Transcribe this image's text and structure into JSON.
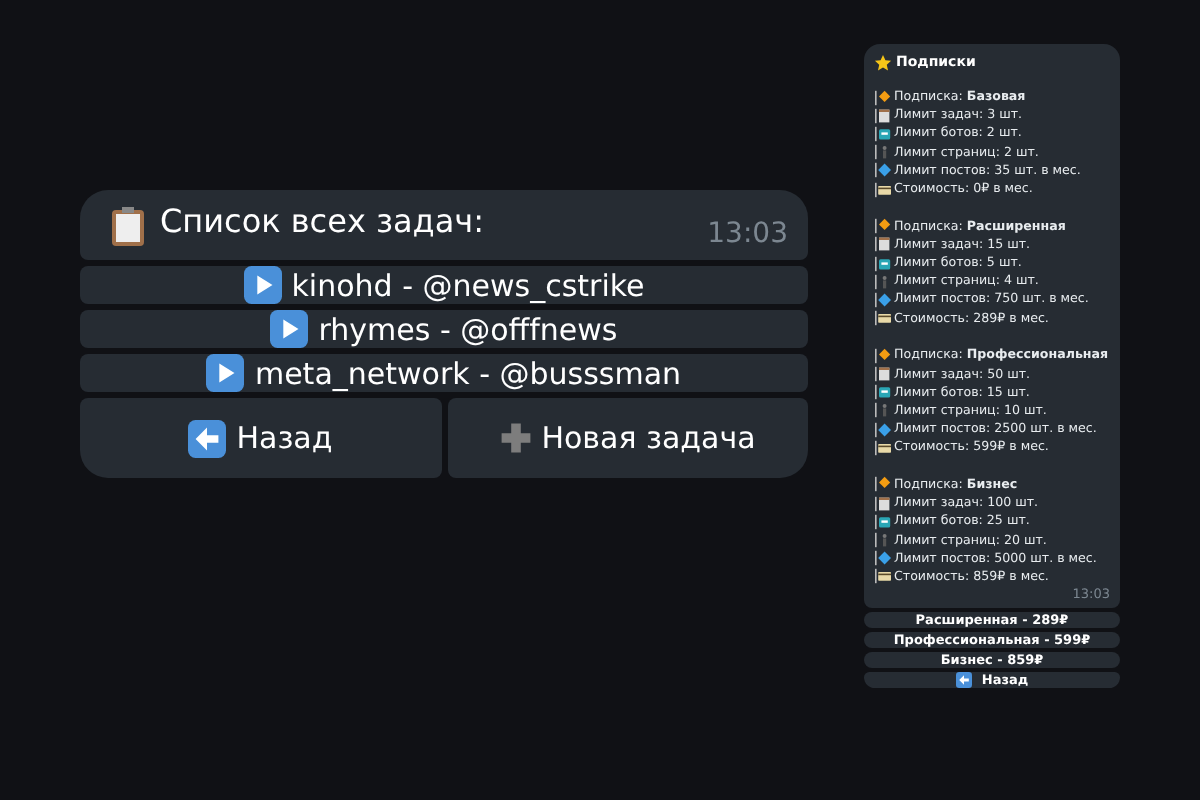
{
  "task_list": {
    "title": "Список всех задач:",
    "time": "13:03",
    "tasks": [
      "kinohd - @news_cstrike",
      "rhymes - @offfnews",
      "meta_network - @busssman"
    ],
    "back_button": "Назад",
    "new_task_button": "Новая задача"
  },
  "subscriptions": {
    "title": "Подписки",
    "time": "13:03",
    "plans": [
      {
        "lines": [
          {
            "kind": "plan",
            "text": "Подписка: **Базовая**"
          },
          {
            "kind": "tasks",
            "text": "Лимит задач: 3 шт."
          },
          {
            "kind": "bots",
            "text": "Лимит ботов: 2 шт."
          },
          {
            "kind": "pages",
            "text": "Лимит страниц: 2 шт."
          },
          {
            "kind": "posts",
            "text": "Лимит постов: 35 шт. в мес."
          },
          {
            "kind": "cost",
            "text": "Стоимость: 0₽ в мес."
          }
        ]
      },
      {
        "lines": [
          {
            "kind": "plan",
            "text": "Подписка: **Расширенная**"
          },
          {
            "kind": "tasks",
            "text": "Лимит задач: 15 шт."
          },
          {
            "kind": "bots",
            "text": "Лимит ботов: 5 шт."
          },
          {
            "kind": "pages",
            "text": "Лимит страниц: 4 шт."
          },
          {
            "kind": "posts",
            "text": "Лимит постов: 750 шт. в мес."
          },
          {
            "kind": "cost",
            "text": "Стоимость: 289₽ в мес."
          }
        ]
      },
      {
        "lines": [
          {
            "kind": "plan",
            "text": "Подписка: **Профессиональная**"
          },
          {
            "kind": "tasks",
            "text": "Лимит задач: 50 шт."
          },
          {
            "kind": "bots",
            "text": "Лимит ботов: 15 шт."
          },
          {
            "kind": "pages",
            "text": "Лимит страниц: 10 шт."
          },
          {
            "kind": "posts",
            "text": "Лимит постов: 2500 шт. в мес."
          },
          {
            "kind": "cost",
            "text": "Стоимость: 599₽ в мес."
          }
        ]
      },
      {
        "lines": [
          {
            "kind": "plan",
            "text": "Подписка: **Бизнес**"
          },
          {
            "kind": "tasks",
            "text": "Лимит задач: 100 шт."
          },
          {
            "kind": "bots",
            "text": "Лимит ботов: 25 шт."
          },
          {
            "kind": "pages",
            "text": "Лимит страниц: 20 шт."
          },
          {
            "kind": "posts",
            "text": "Лимит постов: 5000 шт. в мес."
          },
          {
            "kind": "cost",
            "text": "Стоимость: 859₽ в мес."
          }
        ]
      }
    ],
    "plan_buttons": [
      "Расширенная - 289₽",
      "Профессиональная - 599₽",
      "Бизнес - 859₽"
    ],
    "back_button": "Назад"
  }
}
